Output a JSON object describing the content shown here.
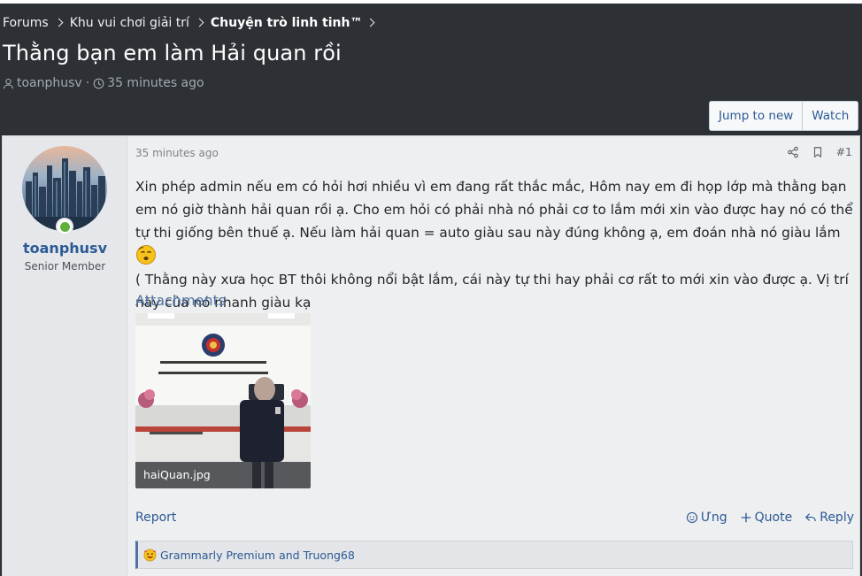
{
  "breadcrumb": {
    "item1": "Forums",
    "item2": "Khu vui chơi giải trí",
    "item3": "Chuyện trò linh tinh™"
  },
  "thread": {
    "title": "Thằng bạn em làm Hải quan rồi",
    "author": "toanphusv",
    "time": "35 minutes ago"
  },
  "actions": {
    "jump": "Jump to new",
    "watch": "Watch"
  },
  "post": {
    "username": "toanphusv",
    "user_title": "Senior Member",
    "date": "35 minutes ago",
    "number": "#1",
    "body_line1": "Xin phép admin nếu em có hỏi hơi nhiều vì em đang rất thắc mắc, Hôm nay em đi họp lớp mà thằng bạn em nó giờ thành hải quan rồi ạ. Cho em hỏi có phải nhà nó phải cơ to lắm mới xin vào được hay nó có thể tự thi giống bên thuế ạ. Nếu làm hải quan = auto giàu sau này đúng không ạ, em đoán nhà nó giàu lắm",
    "body_line2": "( Thằng này xưa học BT thôi không nổi bật lắm, cái này tự thi hay phải cơ rất to mới xin vào được ạ. Vị trí này của nó nhanh giàu kạ",
    "attachments_heading": "Attachments",
    "attachment_name": "haiQuan.jpg",
    "report": "Report",
    "react": "Ưng",
    "quote": "Quote",
    "reply": "Reply",
    "reactions": "Grammarly Premium and Truong68"
  },
  "colors": {
    "background": "#2d3035",
    "post_bg": "#eeeff1",
    "link": "#2c5a94",
    "online": "#5fb13a"
  },
  "icons": [
    "user-icon",
    "clock-icon",
    "share-icon",
    "bookmark-icon",
    "react-icon",
    "plus-icon",
    "reply-icon",
    "emoji-icon",
    "online-icon"
  ]
}
